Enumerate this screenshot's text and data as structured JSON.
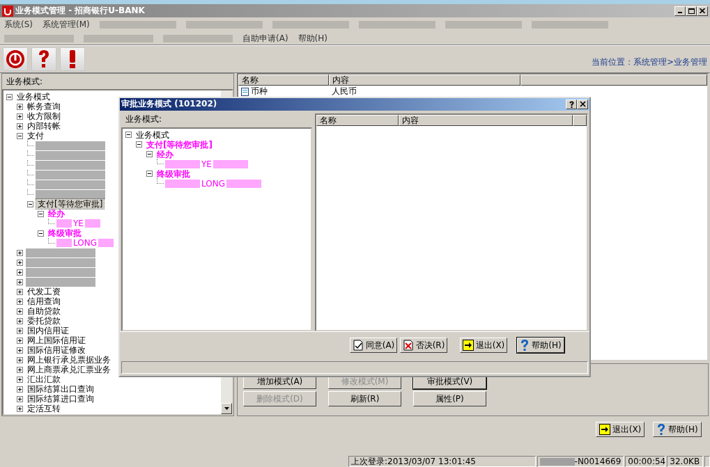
{
  "window": {
    "title": "业务模式管理 - 招商银行U-BANK"
  },
  "menu_rows": [
    [
      {
        "kind": "item",
        "label": "系统(S)"
      },
      {
        "kind": "item",
        "label": "系统管理(M)"
      },
      {
        "kind": "redacted"
      },
      {
        "kind": "redacted"
      },
      {
        "kind": "redacted"
      },
      {
        "kind": "redacted"
      },
      {
        "kind": "redacted"
      },
      {
        "kind": "redacted"
      }
    ],
    [
      {
        "kind": "redacted"
      },
      {
        "kind": "redacted"
      },
      {
        "kind": "redacted"
      },
      {
        "kind": "item",
        "label": "自助申请(A)"
      },
      {
        "kind": "item",
        "label": "帮助(H)"
      }
    ]
  ],
  "toolbar": [
    {
      "kind": "power"
    },
    {
      "kind": "question"
    },
    {
      "kind": "exclamation"
    }
  ],
  "location": "当前位置：系统管理>业务管理",
  "left_panel": {
    "title": "业务模式:",
    "tree": [
      {
        "label": "业务模式",
        "expanded": true,
        "selected": false,
        "children": [
          {
            "label": "帐务查询",
            "expanded": false,
            "selected": false
          },
          {
            "label": "收方限制",
            "expanded": false,
            "selected": false
          },
          {
            "label": "内部转帐",
            "expanded": false,
            "selected": false
          },
          {
            "label": "支付",
            "expanded": true,
            "selected": false,
            "children": [
              {
                "kind": "redacted"
              },
              {
                "kind": "redacted"
              },
              {
                "kind": "redacted"
              },
              {
                "kind": "redacted"
              },
              {
                "kind": "redacted"
              },
              {
                "kind": "redacted"
              },
              {
                "label": "支付[等待您审批]",
                "expanded": true,
                "selected": true,
                "children": [
                  {
                    "label": "经办",
                    "color": "#ff00ff",
                    "expanded": true,
                    "selected": false,
                    "children": [
                      {
                        "kind": "redacted_leaf",
                        "label": "YE",
                        "color": "#ff00ff"
                      }
                    ]
                  },
                  {
                    "label": "终级审批",
                    "color": "#ff00ff",
                    "expanded": true,
                    "selected": false,
                    "children": [
                      {
                        "kind": "redacted_leaf",
                        "label": "LONG",
                        "color": "#ff00ff"
                      }
                    ]
                  }
                ]
              }
            ]
          },
          {
            "kind": "redacted_branch",
            "expanded": false
          },
          {
            "kind": "redacted_branch",
            "expanded": false
          },
          {
            "kind": "redacted_branch",
            "expanded": false
          },
          {
            "kind": "redacted_branch",
            "expanded": false
          },
          {
            "label": "代发工资",
            "expanded": false,
            "selected": false
          },
          {
            "label": "信用查询",
            "expanded": false,
            "selected": false
          },
          {
            "label": "自助贷款",
            "expanded": false,
            "selected": false
          },
          {
            "label": "委托贷款",
            "expanded": false,
            "selected": false
          },
          {
            "label": "国内信用证",
            "expanded": false,
            "selected": false
          },
          {
            "label": "网上国际信用证",
            "expanded": false,
            "selected": false
          },
          {
            "label": "国际信用证修改",
            "expanded": false,
            "selected": false
          },
          {
            "label": "网上银行承兑票据业务",
            "expanded": false,
            "selected": false
          },
          {
            "label": "网上商票承兑汇票业务",
            "expanded": false,
            "selected": false
          },
          {
            "label": "汇出汇款",
            "expanded": false,
            "selected": false
          },
          {
            "label": "国际结算出口查询",
            "expanded": false,
            "selected": false
          },
          {
            "label": "国际结算进口查询",
            "expanded": false,
            "selected": false
          },
          {
            "label": "定活互转",
            "expanded": false,
            "selected": false
          }
        ]
      }
    ]
  },
  "detail_table": {
    "columns": [
      "名称",
      "内容"
    ],
    "rows": [
      [
        "币种",
        "人民币"
      ]
    ]
  },
  "mode_buttons": [
    {
      "label": "增加模式(A)",
      "disabled": false,
      "focused": false
    },
    {
      "label": "修改模式(M)",
      "disabled": true,
      "focused": false
    },
    {
      "label": "审批模式(V)",
      "disabled": false,
      "focused": true
    },
    {
      "label": "删除模式(D)",
      "disabled": true,
      "focused": false
    },
    {
      "label": "刷新(R)",
      "disabled": false,
      "focused": false
    },
    {
      "label": "属性(P)",
      "disabled": false,
      "focused": false
    }
  ],
  "bottom_buttons": [
    {
      "kind": "exit",
      "label": "退出(X)",
      "focused": false
    },
    {
      "kind": "help",
      "label": "帮助(H)",
      "focused": false
    }
  ],
  "status_bar": [
    {
      "kind": "text",
      "text": "上次登录:2013/03/07 13:01:45"
    },
    {
      "kind": "redacted_text",
      "text": "-N0014669"
    },
    {
      "kind": "text",
      "text": "00:00:54"
    },
    {
      "kind": "text",
      "text": "32.0KB"
    },
    {
      "kind": "empty"
    }
  ],
  "dialog": {
    "title": "审批业务模式 (101202)",
    "tree_title": "业务模式:",
    "tree": [
      {
        "label": "业务模式",
        "expanded": true,
        "selected": false,
        "children": [
          {
            "label": "支付[等待您审批]",
            "color": "#ff00ff",
            "expanded": true,
            "selected": false,
            "children": [
              {
                "label": "经办",
                "color": "#ff00ff",
                "expanded": true,
                "selected": false,
                "children": [
                  {
                    "kind": "redacted_leaf",
                    "label": "YE",
                    "color": "#ff00ff"
                  }
                ]
              },
              {
                "label": "终级审批",
                "color": "#ff00ff",
                "expanded": true,
                "selected": false,
                "children": [
                  {
                    "kind": "redacted_leaf",
                    "label": "LONG",
                    "color": "#ff00ff"
                  }
                ]
              }
            ]
          }
        ]
      }
    ],
    "columns": [
      "名称",
      "内容"
    ],
    "buttons": [
      {
        "kind": "approve",
        "label": "同意(A)",
        "focused": false
      },
      {
        "kind": "reject",
        "label": "否决(R)",
        "focused": false
      },
      {
        "kind": "exit",
        "label": "退出(X)",
        "focused": false
      },
      {
        "kind": "help",
        "label": "帮助(H)",
        "focused": true
      }
    ]
  }
}
